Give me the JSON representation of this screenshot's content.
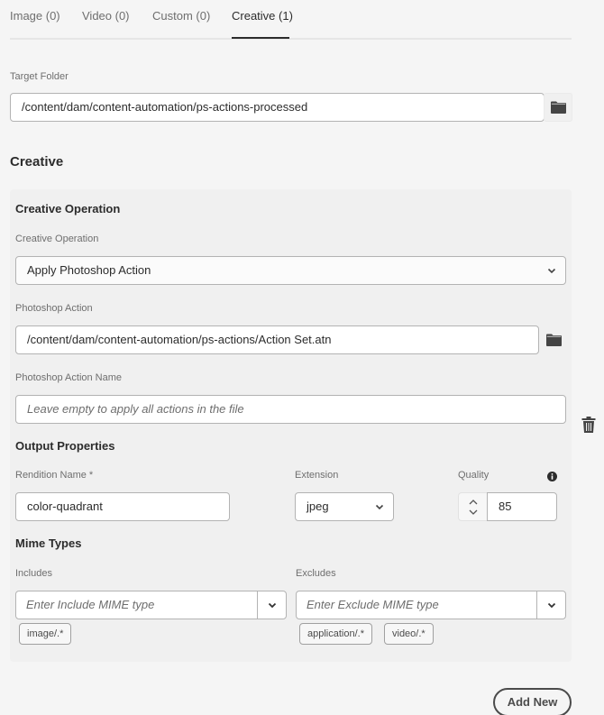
{
  "tabs": [
    {
      "label": "Image (0)",
      "active": false
    },
    {
      "label": "Video (0)",
      "active": false
    },
    {
      "label": "Custom (0)",
      "active": false
    },
    {
      "label": "Creative (1)",
      "active": true
    }
  ],
  "target_folder": {
    "label": "Target Folder",
    "value": "/content/dam/content-automation/ps-actions-processed",
    "browse_icon": "folder-icon"
  },
  "section_title": "Creative",
  "creative_panel": {
    "title": "Creative Operation",
    "operation": {
      "label": "Creative Operation",
      "selected": "Apply Photoshop Action"
    },
    "photoshop_action": {
      "label": "Photoshop Action",
      "value": "/content/dam/content-automation/ps-actions/Action Set.atn",
      "browse_icon": "folder-icon"
    },
    "photoshop_action_name": {
      "label": "Photoshop Action Name",
      "placeholder": "Leave empty to apply all actions in the file",
      "value": ""
    },
    "output_properties": {
      "title": "Output Properties",
      "rendition_name": {
        "label": "Rendition Name *",
        "value": "color-quadrant"
      },
      "extension": {
        "label": "Extension",
        "selected": "jpeg"
      },
      "quality": {
        "label": "Quality",
        "value": "85",
        "info_icon": "info-icon"
      }
    },
    "mime_types": {
      "title": "Mime Types",
      "includes": {
        "label": "Includes",
        "placeholder": "Enter Include MIME type",
        "tags": [
          "image/.*"
        ]
      },
      "excludes": {
        "label": "Excludes",
        "placeholder": "Enter Exclude MIME type",
        "tags": [
          "application/.*",
          "video/.*"
        ]
      }
    },
    "delete_icon": "trash-icon"
  },
  "add_new_label": "Add New"
}
